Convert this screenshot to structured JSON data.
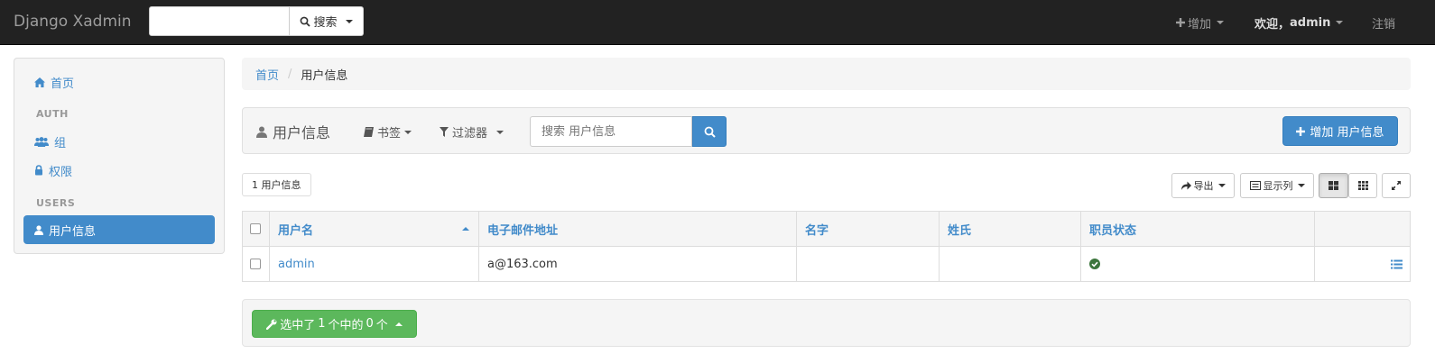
{
  "navbar": {
    "brand": "Django Xadmin",
    "search_placeholder": "",
    "search_button": "搜索",
    "add_menu": "增加",
    "welcome": "欢迎，",
    "username": "admin",
    "logout": "注销"
  },
  "sidebar": {
    "home": "首页",
    "auth_header": "AUTH",
    "group": "组",
    "permission": "权限",
    "users_header": "USERS",
    "userinfo": "用户信息"
  },
  "breadcrumb": {
    "home": "首页",
    "current": "用户信息"
  },
  "toolbar": {
    "title": "用户信息",
    "bookmarks": "书签",
    "filters": "过滤器",
    "search_placeholder": "搜索 用户信息",
    "add_button": "增加 用户信息"
  },
  "results": {
    "count": "1 用户信息",
    "export": "导出",
    "columns": "显示列"
  },
  "table": {
    "headers": [
      "用户名",
      "电子邮件地址",
      "名字",
      "姓氏",
      "职员状态"
    ],
    "rows": [
      {
        "username": "admin",
        "email": "a@163.com",
        "first_name": "",
        "last_name": "",
        "is_staff": true
      }
    ]
  },
  "actions": {
    "selected_prefix": "选中了 ",
    "total": "1",
    "middle": " 个中的 ",
    "selected": "0",
    "suffix": " 个"
  },
  "colors": {
    "primary": "#428bca",
    "success": "#5cb85c",
    "navbar": "#222222",
    "check_ok": "#3c763d"
  }
}
